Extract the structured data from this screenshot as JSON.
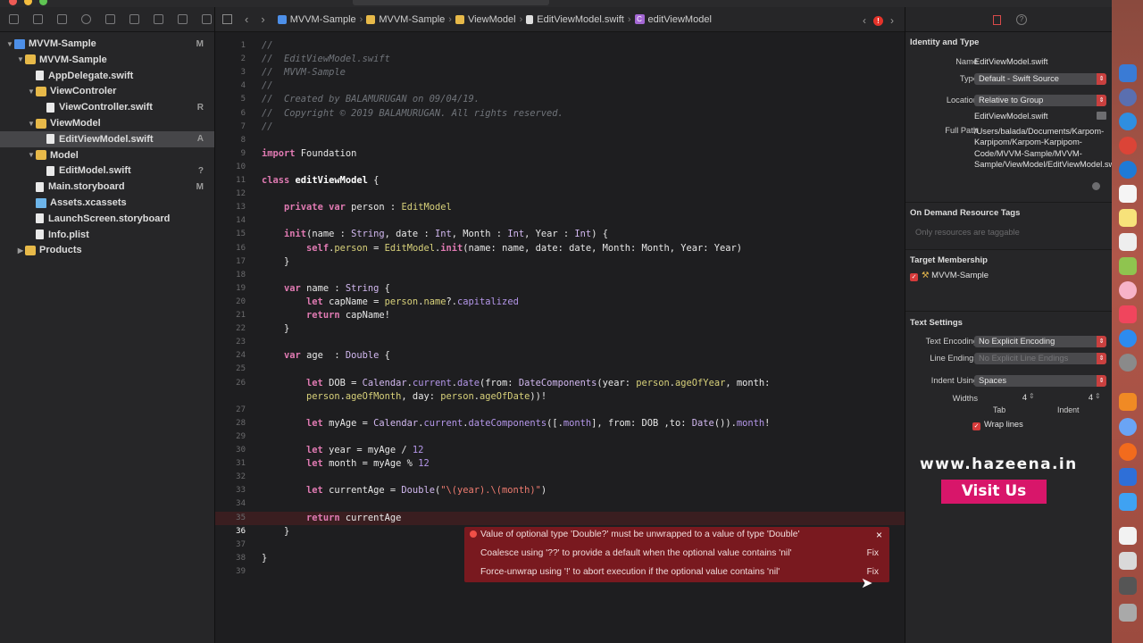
{
  "navigator": {
    "items": [
      {
        "label": "MVVM-Sample",
        "badge": "M",
        "kind": "proj",
        "level": 0,
        "open": true
      },
      {
        "label": "MVVM-Sample",
        "badge": "",
        "kind": "folder",
        "level": 1,
        "open": true
      },
      {
        "label": "AppDelegate.swift",
        "badge": "",
        "kind": "file",
        "level": 2
      },
      {
        "label": "ViewControler",
        "badge": "",
        "kind": "folder",
        "level": 2,
        "open": true
      },
      {
        "label": "ViewController.swift",
        "badge": "R",
        "kind": "file",
        "level": 3
      },
      {
        "label": "ViewModel",
        "badge": "",
        "kind": "folder",
        "level": 2,
        "open": true
      },
      {
        "label": "EditViewModel.swift",
        "badge": "A",
        "kind": "file",
        "level": 3,
        "selected": true
      },
      {
        "label": "Model",
        "badge": "",
        "kind": "folder",
        "level": 2,
        "open": true
      },
      {
        "label": "EditModel.swift",
        "badge": "?",
        "kind": "file",
        "level": 3
      },
      {
        "label": "Main.storyboard",
        "badge": "M",
        "kind": "file",
        "level": 2
      },
      {
        "label": "Assets.xcassets",
        "badge": "",
        "kind": "assets",
        "level": 2
      },
      {
        "label": "LaunchScreen.storyboard",
        "badge": "",
        "kind": "file",
        "level": 2
      },
      {
        "label": "Info.plist",
        "badge": "",
        "kind": "file",
        "level": 2
      },
      {
        "label": "Products",
        "badge": "",
        "kind": "folder",
        "level": 1,
        "open": false
      }
    ]
  },
  "jumpbar": {
    "crumbs": [
      {
        "label": "MVVM-Sample",
        "icon": "project-icon"
      },
      {
        "label": "MVVM-Sample",
        "icon": "folder-icon"
      },
      {
        "label": "ViewModel",
        "icon": "folder-icon"
      },
      {
        "label": "EditViewModel.swift",
        "icon": "swift-file-icon"
      },
      {
        "label": "editViewModel",
        "icon": "class-icon"
      }
    ],
    "class_glyph": "C",
    "error_glyph": "!"
  },
  "editor": {
    "lines": [
      {
        "n": "1",
        "html": "<span class='c'>//</span>"
      },
      {
        "n": "2",
        "html": "<span class='c'>//  EditViewModel.swift</span>"
      },
      {
        "n": "3",
        "html": "<span class='c'>//  MVVM-Sample</span>"
      },
      {
        "n": "4",
        "html": "<span class='c'>//</span>"
      },
      {
        "n": "5",
        "html": "<span class='c'>//  Created by BALAMURUGAN on 09/04/19.</span>"
      },
      {
        "n": "6",
        "html": "<span class='c'>//  Copyright © 2019 BALAMURUGAN. All rights reserved.</span>"
      },
      {
        "n": "7",
        "html": "<span class='c'>//</span>"
      },
      {
        "n": "8",
        "html": ""
      },
      {
        "n": "9",
        "html": "<span class='k'>import</span> Foundation"
      },
      {
        "n": "10",
        "html": ""
      },
      {
        "n": "11",
        "html": "<span class='k'>class</span> <span class='ident'>editViewModel</span> {"
      },
      {
        "n": "12",
        "html": ""
      },
      {
        "n": "13",
        "html": "    <span class='k'>private</span> <span class='k'>var</span> person : <span class='y'>EditModel</span>"
      },
      {
        "n": "14",
        "html": ""
      },
      {
        "n": "15",
        "html": "    <span class='k'>init</span>(name : <span class='t'>String</span>, date : <span class='t'>Int</span>, Month : <span class='t'>Int</span>, Year : <span class='t'>Int</span>) {"
      },
      {
        "n": "16",
        "html": "        <span class='k'>self</span>.<span class='y'>person</span> = <span class='y'>EditModel</span>.<span class='k'>init</span>(name: name, date: date, Month: Month, Year: Year)"
      },
      {
        "n": "17",
        "html": "    }"
      },
      {
        "n": "18",
        "html": ""
      },
      {
        "n": "19",
        "html": "    <span class='k'>var</span> name : <span class='t'>String</span> {"
      },
      {
        "n": "20",
        "html": "        <span class='k'>let</span> capName = <span class='y'>person</span>.<span class='y'>name</span>?.<span class='m'>capitalized</span>"
      },
      {
        "n": "21",
        "html": "        <span class='k'>return</span> capName!"
      },
      {
        "n": "22",
        "html": "    }"
      },
      {
        "n": "23",
        "html": ""
      },
      {
        "n": "24",
        "html": "    <span class='k'>var</span> age  : <span class='t'>Double</span> {"
      },
      {
        "n": "25",
        "html": ""
      },
      {
        "n": "26",
        "html": "        <span class='k'>let</span> DOB = <span class='t'>Calendar</span>.<span class='m'>current</span>.<span class='m'>date</span>(from: <span class='t'>DateComponents</span>(year: <span class='y'>person</span>.<span class='y'>ageOfYear</span>, month:"
      },
      {
        "n": "",
        "html": "        <span class='y'>person</span>.<span class='y'>ageOfMonth</span>, day: <span class='y'>person</span>.<span class='y'>ageOfDate</span>))!"
      },
      {
        "n": "27",
        "html": ""
      },
      {
        "n": "28",
        "html": "        <span class='k'>let</span> myAge = <span class='t'>Calendar</span>.<span class='m'>current</span>.<span class='m'>dateComponents</span>([.<span class='m'>month</span>], from: DOB ,to: <span class='t'>Date</span>()).<span class='m'>month</span>!"
      },
      {
        "n": "29",
        "html": ""
      },
      {
        "n": "30",
        "html": "        <span class='k'>let</span> year = myAge / <span class='m'>12</span>"
      },
      {
        "n": "31",
        "html": "        <span class='k'>let</span> month = myAge % <span class='m'>12</span>"
      },
      {
        "n": "32",
        "html": ""
      },
      {
        "n": "33",
        "html": "        <span class='k'>let</span> currentAge = <span class='t'>Double</span>(<span class='s'>\"\\(year).\\(month)\"</span>)"
      },
      {
        "n": "34",
        "html": ""
      },
      {
        "n": "35",
        "html": "        <span class='k'>return</span> currentAge",
        "error": true
      },
      {
        "n": "36",
        "html": "    }",
        "current": true
      },
      {
        "n": "37",
        "html": ""
      },
      {
        "n": "38",
        "html": "}"
      },
      {
        "n": "39",
        "html": ""
      }
    ]
  },
  "error_popover": {
    "message": "Value of optional type 'Double?' must be unwrapped to a value of type 'Double'",
    "fixits": [
      {
        "label": "Coalesce using '??' to provide a default when the optional value contains 'nil'",
        "action": "Fix"
      },
      {
        "label": "Force-unwrap using '!' to abort execution if the optional value contains 'nil'",
        "action": "Fix"
      }
    ],
    "close_glyph": "×"
  },
  "inspector": {
    "identity": {
      "heading": "Identity and Type",
      "name_label": "Name",
      "name_value": "EditViewModel.swift",
      "type_label": "Type",
      "type_value": "Default - Swift Source",
      "location_label": "Location",
      "location_value": "Relative to Group",
      "location_file": "EditViewModel.swift",
      "fullpath_label": "Full Path",
      "fullpath_value": "/Users/balada/Documents/Karpom-Karpipom/Karpom-Karpipom-Code/MVVM-Sample/MVVM-Sample/ViewModel/EditViewModel.swift"
    },
    "odr": {
      "heading": "On Demand Resource Tags",
      "placeholder": "Only resources are taggable"
    },
    "membership": {
      "heading": "Target Membership",
      "target": "MVVM-Sample"
    },
    "text": {
      "heading": "Text Settings",
      "encoding_label": "Text Encoding",
      "encoding_value": "No Explicit Encoding",
      "endings_label": "Line Endings",
      "endings_value": "No Explicit Line Endings",
      "indent_label": "Indent Using",
      "indent_value": "Spaces",
      "widths_label": "Widths",
      "tab_value": "4",
      "indent_width_value": "4",
      "tab_caption": "Tab",
      "indent_caption": "Indent",
      "wrap_label": "Wrap lines"
    }
  },
  "watermark": {
    "url": "www.hazeena.in",
    "button": "Visit Us"
  },
  "colors": {
    "error": "#79191f",
    "accent": "#c9403f",
    "watermark": "#d8166a"
  }
}
